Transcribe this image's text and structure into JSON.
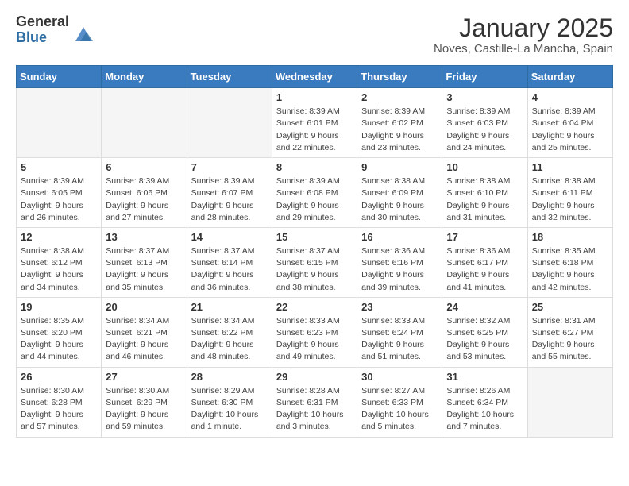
{
  "header": {
    "logo_general": "General",
    "logo_blue": "Blue",
    "month_title": "January 2025",
    "location": "Noves, Castille-La Mancha, Spain"
  },
  "weekdays": [
    "Sunday",
    "Monday",
    "Tuesday",
    "Wednesday",
    "Thursday",
    "Friday",
    "Saturday"
  ],
  "weeks": [
    [
      {
        "day": "",
        "info": ""
      },
      {
        "day": "",
        "info": ""
      },
      {
        "day": "",
        "info": ""
      },
      {
        "day": "1",
        "info": "Sunrise: 8:39 AM\nSunset: 6:01 PM\nDaylight: 9 hours\nand 22 minutes."
      },
      {
        "day": "2",
        "info": "Sunrise: 8:39 AM\nSunset: 6:02 PM\nDaylight: 9 hours\nand 23 minutes."
      },
      {
        "day": "3",
        "info": "Sunrise: 8:39 AM\nSunset: 6:03 PM\nDaylight: 9 hours\nand 24 minutes."
      },
      {
        "day": "4",
        "info": "Sunrise: 8:39 AM\nSunset: 6:04 PM\nDaylight: 9 hours\nand 25 minutes."
      }
    ],
    [
      {
        "day": "5",
        "info": "Sunrise: 8:39 AM\nSunset: 6:05 PM\nDaylight: 9 hours\nand 26 minutes."
      },
      {
        "day": "6",
        "info": "Sunrise: 8:39 AM\nSunset: 6:06 PM\nDaylight: 9 hours\nand 27 minutes."
      },
      {
        "day": "7",
        "info": "Sunrise: 8:39 AM\nSunset: 6:07 PM\nDaylight: 9 hours\nand 28 minutes."
      },
      {
        "day": "8",
        "info": "Sunrise: 8:39 AM\nSunset: 6:08 PM\nDaylight: 9 hours\nand 29 minutes."
      },
      {
        "day": "9",
        "info": "Sunrise: 8:38 AM\nSunset: 6:09 PM\nDaylight: 9 hours\nand 30 minutes."
      },
      {
        "day": "10",
        "info": "Sunrise: 8:38 AM\nSunset: 6:10 PM\nDaylight: 9 hours\nand 31 minutes."
      },
      {
        "day": "11",
        "info": "Sunrise: 8:38 AM\nSunset: 6:11 PM\nDaylight: 9 hours\nand 32 minutes."
      }
    ],
    [
      {
        "day": "12",
        "info": "Sunrise: 8:38 AM\nSunset: 6:12 PM\nDaylight: 9 hours\nand 34 minutes."
      },
      {
        "day": "13",
        "info": "Sunrise: 8:37 AM\nSunset: 6:13 PM\nDaylight: 9 hours\nand 35 minutes."
      },
      {
        "day": "14",
        "info": "Sunrise: 8:37 AM\nSunset: 6:14 PM\nDaylight: 9 hours\nand 36 minutes."
      },
      {
        "day": "15",
        "info": "Sunrise: 8:37 AM\nSunset: 6:15 PM\nDaylight: 9 hours\nand 38 minutes."
      },
      {
        "day": "16",
        "info": "Sunrise: 8:36 AM\nSunset: 6:16 PM\nDaylight: 9 hours\nand 39 minutes."
      },
      {
        "day": "17",
        "info": "Sunrise: 8:36 AM\nSunset: 6:17 PM\nDaylight: 9 hours\nand 41 minutes."
      },
      {
        "day": "18",
        "info": "Sunrise: 8:35 AM\nSunset: 6:18 PM\nDaylight: 9 hours\nand 42 minutes."
      }
    ],
    [
      {
        "day": "19",
        "info": "Sunrise: 8:35 AM\nSunset: 6:20 PM\nDaylight: 9 hours\nand 44 minutes."
      },
      {
        "day": "20",
        "info": "Sunrise: 8:34 AM\nSunset: 6:21 PM\nDaylight: 9 hours\nand 46 minutes."
      },
      {
        "day": "21",
        "info": "Sunrise: 8:34 AM\nSunset: 6:22 PM\nDaylight: 9 hours\nand 48 minutes."
      },
      {
        "day": "22",
        "info": "Sunrise: 8:33 AM\nSunset: 6:23 PM\nDaylight: 9 hours\nand 49 minutes."
      },
      {
        "day": "23",
        "info": "Sunrise: 8:33 AM\nSunset: 6:24 PM\nDaylight: 9 hours\nand 51 minutes."
      },
      {
        "day": "24",
        "info": "Sunrise: 8:32 AM\nSunset: 6:25 PM\nDaylight: 9 hours\nand 53 minutes."
      },
      {
        "day": "25",
        "info": "Sunrise: 8:31 AM\nSunset: 6:27 PM\nDaylight: 9 hours\nand 55 minutes."
      }
    ],
    [
      {
        "day": "26",
        "info": "Sunrise: 8:30 AM\nSunset: 6:28 PM\nDaylight: 9 hours\nand 57 minutes."
      },
      {
        "day": "27",
        "info": "Sunrise: 8:30 AM\nSunset: 6:29 PM\nDaylight: 9 hours\nand 59 minutes."
      },
      {
        "day": "28",
        "info": "Sunrise: 8:29 AM\nSunset: 6:30 PM\nDaylight: 10 hours\nand 1 minute."
      },
      {
        "day": "29",
        "info": "Sunrise: 8:28 AM\nSunset: 6:31 PM\nDaylight: 10 hours\nand 3 minutes."
      },
      {
        "day": "30",
        "info": "Sunrise: 8:27 AM\nSunset: 6:33 PM\nDaylight: 10 hours\nand 5 minutes."
      },
      {
        "day": "31",
        "info": "Sunrise: 8:26 AM\nSunset: 6:34 PM\nDaylight: 10 hours\nand 7 minutes."
      },
      {
        "day": "",
        "info": ""
      }
    ]
  ]
}
